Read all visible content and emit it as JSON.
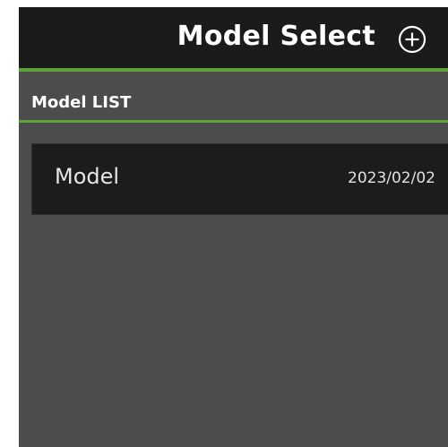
{
  "header": {
    "title": "Model Select",
    "add_icon": "plus-circle-icon"
  },
  "section": {
    "label": "Model LIST"
  },
  "models": [
    {
      "name": "Model",
      "date": "2023/02/02"
    }
  ],
  "colors": {
    "header_bg": "#1b1b1b",
    "body_bg": "#4c4c4c",
    "accent": "#5ea33a",
    "card_bg": "#1c1c1c",
    "text": "#ffffff"
  }
}
